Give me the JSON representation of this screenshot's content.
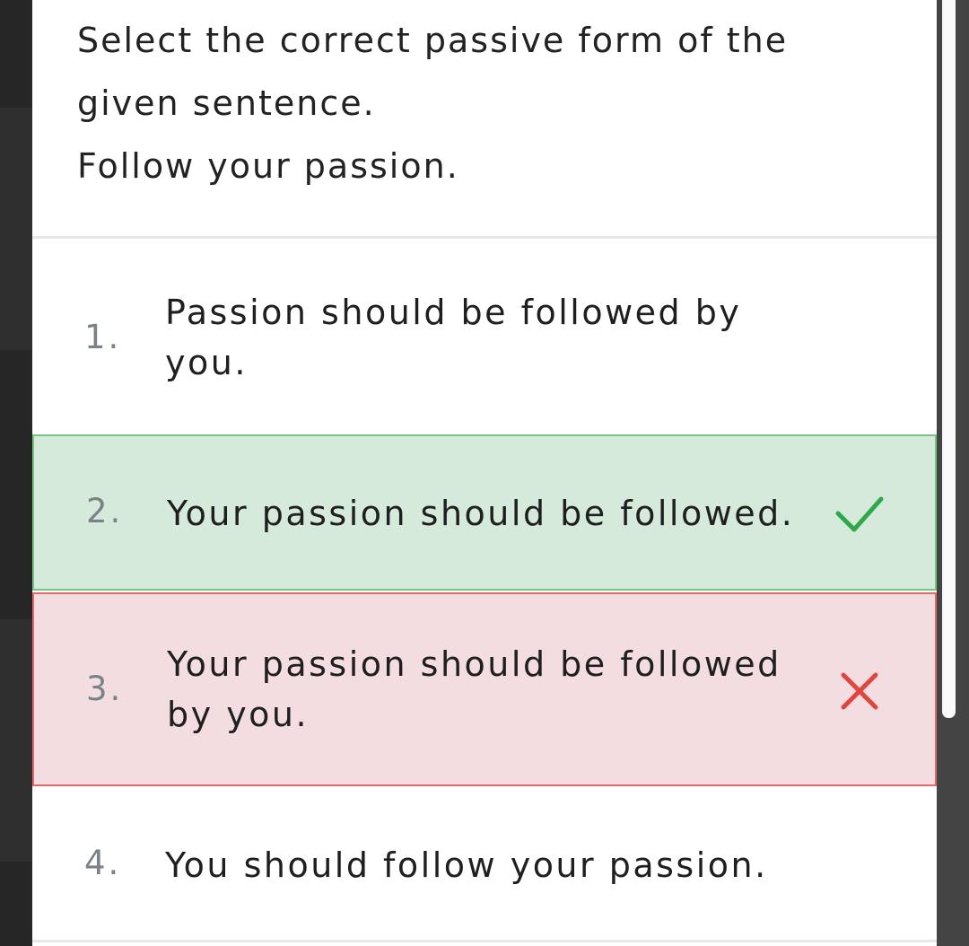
{
  "question": {
    "lines": [
      "Select the correct passive form of the",
      "given sentence.",
      "Follow your passion."
    ]
  },
  "options": [
    {
      "number": "1.",
      "lines": [
        "Passion should be followed by",
        "you."
      ],
      "state": "neutral"
    },
    {
      "number": "2.",
      "lines": [
        "Your passion should be followed."
      ],
      "state": "correct",
      "icon": "check-icon"
    },
    {
      "number": "3.",
      "lines": [
        "Your passion should be followed",
        "by you."
      ],
      "state": "wrong",
      "icon": "cross-icon"
    },
    {
      "number": "4.",
      "lines": [
        "You should follow your passion."
      ],
      "state": "neutral"
    }
  ],
  "colors": {
    "correct_bg": "#d5eadb",
    "correct_border": "#79c57f",
    "correct_icon": "#2fa84a",
    "wrong_bg": "#f3dde0",
    "wrong_border": "#df6a6a",
    "wrong_icon": "#e0453f"
  }
}
